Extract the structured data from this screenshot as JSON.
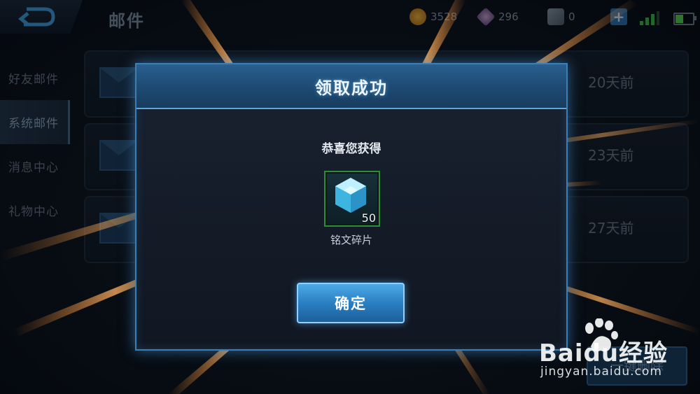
{
  "header": {
    "title": "邮件",
    "gold": "3528",
    "diamonds": "296",
    "tickets": "0"
  },
  "sidebar": {
    "items": [
      {
        "label": "好友邮件",
        "active": false
      },
      {
        "label": "系统邮件",
        "active": true
      },
      {
        "label": "消息中心",
        "active": false
      },
      {
        "label": "礼物中心",
        "active": false
      }
    ]
  },
  "mails": [
    {
      "time": "20天前"
    },
    {
      "time": "23天前"
    },
    {
      "time": "27天前"
    }
  ],
  "delete_label": "一键删除",
  "modal": {
    "title": "领取成功",
    "message": "恭喜您获得",
    "item": {
      "name": "铭文碎片",
      "count": "50",
      "icon": "crystal-icon"
    },
    "confirm_label": "确定"
  },
  "watermark": {
    "logo": "Baidu经验",
    "url": "jingyan.baidu.com"
  },
  "colors": {
    "accent": "#3d7fb3",
    "button": "#2a7fc2",
    "item_border": "#2f8a3c",
    "battery": "#4fd24a"
  }
}
